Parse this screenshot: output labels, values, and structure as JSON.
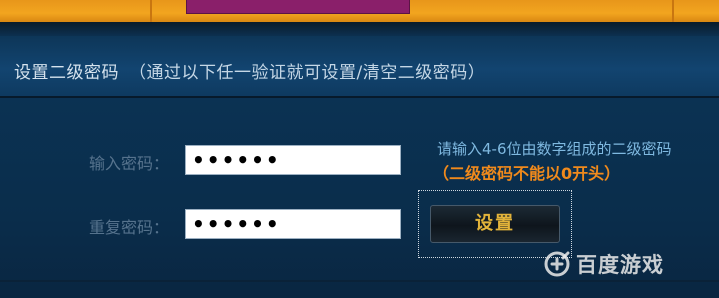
{
  "section": {
    "title": "设置二级密码",
    "hint": "（通过以下任一验证就可设置/清空二级密码）"
  },
  "form": {
    "password_label": "输入密码：",
    "password_value": "••••••",
    "confirm_label": "重复密码：",
    "confirm_value": "••••••",
    "info_rule": "请输入4-6位由数字组成的二级密码",
    "info_warning": "（二级密码不能以0开头）",
    "submit_label": "设置"
  },
  "watermark": {
    "text": "百度游戏",
    "icon": "baidu-game-icon"
  },
  "colors": {
    "header_bg": "#124470",
    "panel_bg": "#0b3253",
    "top_strip": "#f2a51f",
    "warning": "#f08a1c",
    "info": "#7fb9e0",
    "button_text": "#e2b33a"
  }
}
